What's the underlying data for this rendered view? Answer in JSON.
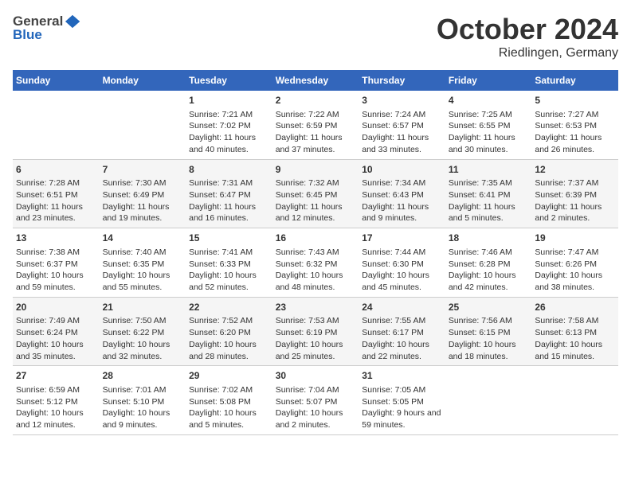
{
  "header": {
    "logo_general": "General",
    "logo_blue": "Blue",
    "title": "October 2024",
    "subtitle": "Riedlingen, Germany"
  },
  "weekdays": [
    "Sunday",
    "Monday",
    "Tuesday",
    "Wednesday",
    "Thursday",
    "Friday",
    "Saturday"
  ],
  "rows": [
    [
      {
        "day": "",
        "sunrise": "",
        "sunset": "",
        "daylight": ""
      },
      {
        "day": "",
        "sunrise": "",
        "sunset": "",
        "daylight": ""
      },
      {
        "day": "1",
        "sunrise": "Sunrise: 7:21 AM",
        "sunset": "Sunset: 7:02 PM",
        "daylight": "Daylight: 11 hours and 40 minutes."
      },
      {
        "day": "2",
        "sunrise": "Sunrise: 7:22 AM",
        "sunset": "Sunset: 6:59 PM",
        "daylight": "Daylight: 11 hours and 37 minutes."
      },
      {
        "day": "3",
        "sunrise": "Sunrise: 7:24 AM",
        "sunset": "Sunset: 6:57 PM",
        "daylight": "Daylight: 11 hours and 33 minutes."
      },
      {
        "day": "4",
        "sunrise": "Sunrise: 7:25 AM",
        "sunset": "Sunset: 6:55 PM",
        "daylight": "Daylight: 11 hours and 30 minutes."
      },
      {
        "day": "5",
        "sunrise": "Sunrise: 7:27 AM",
        "sunset": "Sunset: 6:53 PM",
        "daylight": "Daylight: 11 hours and 26 minutes."
      }
    ],
    [
      {
        "day": "6",
        "sunrise": "Sunrise: 7:28 AM",
        "sunset": "Sunset: 6:51 PM",
        "daylight": "Daylight: 11 hours and 23 minutes."
      },
      {
        "day": "7",
        "sunrise": "Sunrise: 7:30 AM",
        "sunset": "Sunset: 6:49 PM",
        "daylight": "Daylight: 11 hours and 19 minutes."
      },
      {
        "day": "8",
        "sunrise": "Sunrise: 7:31 AM",
        "sunset": "Sunset: 6:47 PM",
        "daylight": "Daylight: 11 hours and 16 minutes."
      },
      {
        "day": "9",
        "sunrise": "Sunrise: 7:32 AM",
        "sunset": "Sunset: 6:45 PM",
        "daylight": "Daylight: 11 hours and 12 minutes."
      },
      {
        "day": "10",
        "sunrise": "Sunrise: 7:34 AM",
        "sunset": "Sunset: 6:43 PM",
        "daylight": "Daylight: 11 hours and 9 minutes."
      },
      {
        "day": "11",
        "sunrise": "Sunrise: 7:35 AM",
        "sunset": "Sunset: 6:41 PM",
        "daylight": "Daylight: 11 hours and 5 minutes."
      },
      {
        "day": "12",
        "sunrise": "Sunrise: 7:37 AM",
        "sunset": "Sunset: 6:39 PM",
        "daylight": "Daylight: 11 hours and 2 minutes."
      }
    ],
    [
      {
        "day": "13",
        "sunrise": "Sunrise: 7:38 AM",
        "sunset": "Sunset: 6:37 PM",
        "daylight": "Daylight: 10 hours and 59 minutes."
      },
      {
        "day": "14",
        "sunrise": "Sunrise: 7:40 AM",
        "sunset": "Sunset: 6:35 PM",
        "daylight": "Daylight: 10 hours and 55 minutes."
      },
      {
        "day": "15",
        "sunrise": "Sunrise: 7:41 AM",
        "sunset": "Sunset: 6:33 PM",
        "daylight": "Daylight: 10 hours and 52 minutes."
      },
      {
        "day": "16",
        "sunrise": "Sunrise: 7:43 AM",
        "sunset": "Sunset: 6:32 PM",
        "daylight": "Daylight: 10 hours and 48 minutes."
      },
      {
        "day": "17",
        "sunrise": "Sunrise: 7:44 AM",
        "sunset": "Sunset: 6:30 PM",
        "daylight": "Daylight: 10 hours and 45 minutes."
      },
      {
        "day": "18",
        "sunrise": "Sunrise: 7:46 AM",
        "sunset": "Sunset: 6:28 PM",
        "daylight": "Daylight: 10 hours and 42 minutes."
      },
      {
        "day": "19",
        "sunrise": "Sunrise: 7:47 AM",
        "sunset": "Sunset: 6:26 PM",
        "daylight": "Daylight: 10 hours and 38 minutes."
      }
    ],
    [
      {
        "day": "20",
        "sunrise": "Sunrise: 7:49 AM",
        "sunset": "Sunset: 6:24 PM",
        "daylight": "Daylight: 10 hours and 35 minutes."
      },
      {
        "day": "21",
        "sunrise": "Sunrise: 7:50 AM",
        "sunset": "Sunset: 6:22 PM",
        "daylight": "Daylight: 10 hours and 32 minutes."
      },
      {
        "day": "22",
        "sunrise": "Sunrise: 7:52 AM",
        "sunset": "Sunset: 6:20 PM",
        "daylight": "Daylight: 10 hours and 28 minutes."
      },
      {
        "day": "23",
        "sunrise": "Sunrise: 7:53 AM",
        "sunset": "Sunset: 6:19 PM",
        "daylight": "Daylight: 10 hours and 25 minutes."
      },
      {
        "day": "24",
        "sunrise": "Sunrise: 7:55 AM",
        "sunset": "Sunset: 6:17 PM",
        "daylight": "Daylight: 10 hours and 22 minutes."
      },
      {
        "day": "25",
        "sunrise": "Sunrise: 7:56 AM",
        "sunset": "Sunset: 6:15 PM",
        "daylight": "Daylight: 10 hours and 18 minutes."
      },
      {
        "day": "26",
        "sunrise": "Sunrise: 7:58 AM",
        "sunset": "Sunset: 6:13 PM",
        "daylight": "Daylight: 10 hours and 15 minutes."
      }
    ],
    [
      {
        "day": "27",
        "sunrise": "Sunrise: 6:59 AM",
        "sunset": "Sunset: 5:12 PM",
        "daylight": "Daylight: 10 hours and 12 minutes."
      },
      {
        "day": "28",
        "sunrise": "Sunrise: 7:01 AM",
        "sunset": "Sunset: 5:10 PM",
        "daylight": "Daylight: 10 hours and 9 minutes."
      },
      {
        "day": "29",
        "sunrise": "Sunrise: 7:02 AM",
        "sunset": "Sunset: 5:08 PM",
        "daylight": "Daylight: 10 hours and 5 minutes."
      },
      {
        "day": "30",
        "sunrise": "Sunrise: 7:04 AM",
        "sunset": "Sunset: 5:07 PM",
        "daylight": "Daylight: 10 hours and 2 minutes."
      },
      {
        "day": "31",
        "sunrise": "Sunrise: 7:05 AM",
        "sunset": "Sunset: 5:05 PM",
        "daylight": "Daylight: 9 hours and 59 minutes."
      },
      {
        "day": "",
        "sunrise": "",
        "sunset": "",
        "daylight": ""
      },
      {
        "day": "",
        "sunrise": "",
        "sunset": "",
        "daylight": ""
      }
    ]
  ]
}
